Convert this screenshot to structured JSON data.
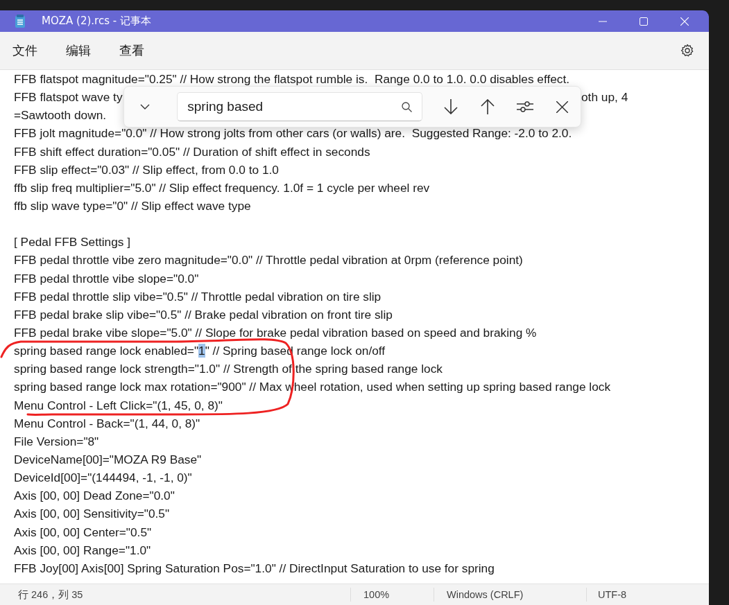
{
  "window": {
    "title": "MOZA (2).rcs - 记事本"
  },
  "menu": [
    "文件",
    "编辑",
    "查看"
  ],
  "find_bar": {
    "query": "spring based"
  },
  "lines": [
    {
      "kind": "text",
      "text": "FFB flatspot magnitude=\"0.25\" // How strong the flatspot rumble is.  Range 0.0 to 1.0. 0.0 disables effect."
    },
    {
      "kind": "split",
      "left": "FFB flatspot wave ty",
      "right": "oth up, 4"
    },
    {
      "kind": "text",
      "text": "=Sawtooth down."
    },
    {
      "kind": "text",
      "text": "FFB jolt magnitude=\"0.0\" // How strong jolts from other cars (or walls) are.  Suggested Range: -2.0 to 2.0."
    },
    {
      "kind": "text",
      "text": "FFB shift effect duration=\"0.05\" // Duration of shift effect in seconds"
    },
    {
      "kind": "text",
      "text": "FFB slip effect=\"0.03\" // Slip effect, from 0.0 to 1.0"
    },
    {
      "kind": "text",
      "text": "ffb slip freq multiplier=\"5.0\" // Slip effect frequency. 1.0f = 1 cycle per wheel rev"
    },
    {
      "kind": "text",
      "text": "ffb slip wave type=\"0\" // Slip effect wave type"
    },
    {
      "kind": "blank"
    },
    {
      "kind": "text",
      "text": "[ Pedal FFB Settings ]"
    },
    {
      "kind": "text",
      "text": "FFB pedal throttle vibe zero magnitude=\"0.0\" // Throttle pedal vibration at 0rpm (reference point)"
    },
    {
      "kind": "text",
      "text": "FFB pedal throttle vibe slope=\"0.0\""
    },
    {
      "kind": "text",
      "text": "FFB pedal throttle slip vibe=\"0.5\" // Throttle pedal vibration on tire slip"
    },
    {
      "kind": "text",
      "text": "FFB pedal brake slip vibe=\"0.5\" // Brake pedal vibration on front tire slip"
    },
    {
      "kind": "text",
      "text": "FFB pedal brake vibe slope=\"5.0\" // Slope for brake pedal vibration based on speed and braking %"
    },
    {
      "kind": "segmented",
      "segments": [
        {
          "text": "spring based range lock enabled=\"",
          "highlighted": false
        },
        {
          "text": "1",
          "highlighted": true
        },
        {
          "text": "\" // Spring based range lock on/off",
          "highlighted": false
        }
      ]
    },
    {
      "kind": "text",
      "text": "spring based range lock strength=\"1.0\" // Strength of the spring based range lock"
    },
    {
      "kind": "text",
      "text": "spring based range lock max rotation=\"900\" // Max wheel rotation, used when setting up spring based range lock"
    },
    {
      "kind": "text",
      "text": "Menu Control - Left Click=\"(1, 45, 0, 8)\""
    },
    {
      "kind": "text",
      "text": "Menu Control - Back=\"(1, 44, 0, 8)\""
    },
    {
      "kind": "text",
      "text": "File Version=\"8\""
    },
    {
      "kind": "text",
      "text": "DeviceName[00]=\"MOZA R9 Base\""
    },
    {
      "kind": "text",
      "text": "DeviceId[00]=\"(144494, -1, -1, 0)\""
    },
    {
      "kind": "text",
      "text": "Axis [00, 00] Dead Zone=\"0.0\""
    },
    {
      "kind": "text",
      "text": "Axis [00, 00] Sensitivity=\"0.5\""
    },
    {
      "kind": "text",
      "text": "Axis [00, 00] Center=\"0.5\""
    },
    {
      "kind": "text",
      "text": "Axis [00, 00] Range=\"1.0\""
    },
    {
      "kind": "text",
      "text": "FFB Joy[00] Axis[00] Spring Saturation Pos=\"1.0\" // DirectInput Saturation to use for spring"
    }
  ],
  "status_bar": {
    "position": "行 246，列 35",
    "zoom": "100%",
    "line_ending": "Windows (CRLF)",
    "encoding": "UTF-8"
  }
}
